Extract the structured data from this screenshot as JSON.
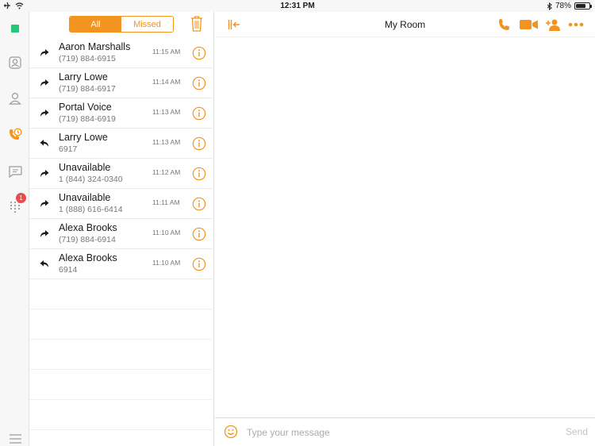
{
  "status_bar": {
    "time": "12:31 PM",
    "battery": "78%",
    "battery_level": 0.78
  },
  "rail": {
    "items": [
      {
        "icon": "presence-status-icon"
      },
      {
        "icon": "contacts-icon"
      },
      {
        "icon": "person-icon"
      },
      {
        "icon": "recent-calls-icon"
      },
      {
        "icon": "chat-icon"
      },
      {
        "icon": "dialpad-icon"
      }
    ],
    "badge_count": "1",
    "menu_icon": "hamburger-menu-icon"
  },
  "filter": {
    "all_label": "All",
    "missed_label": "Missed",
    "selected": "All"
  },
  "calls": [
    {
      "name": "Aaron Marshalls",
      "number": "(719) 884-6915",
      "time": "11:15 AM",
      "direction": "outgoing"
    },
    {
      "name": "Larry Lowe",
      "number": "(719) 884-6917",
      "time": "11:14 AM",
      "direction": "outgoing"
    },
    {
      "name": "Portal Voice",
      "number": "(719) 884-6919",
      "time": "11:13 AM",
      "direction": "outgoing"
    },
    {
      "name": "Larry Lowe",
      "number": "6917",
      "time": "11:13 AM",
      "direction": "incoming"
    },
    {
      "name": "Unavailable",
      "number": "1 (844) 324-0340",
      "time": "11:12 AM",
      "direction": "outgoing"
    },
    {
      "name": "Unavailable",
      "number": "1 (888) 616-6414",
      "time": "11:11 AM",
      "direction": "outgoing"
    },
    {
      "name": "Alexa Brooks",
      "number": "(719) 884-6914",
      "time": "11:10 AM",
      "direction": "outgoing"
    },
    {
      "name": "Alexa Brooks",
      "number": "6914",
      "time": "11:10 AM",
      "direction": "incoming"
    }
  ],
  "chat": {
    "title": "My Room",
    "composer_placeholder": "Type your message",
    "send_label": "Send"
  },
  "colors": {
    "accent": "#f39420",
    "presence": "#27c77a",
    "badge": "#e94c4c"
  }
}
